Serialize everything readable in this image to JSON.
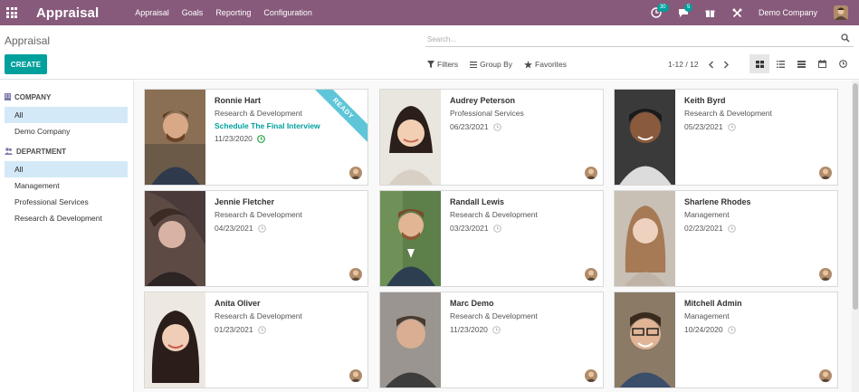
{
  "navbar": {
    "brand": "Appraisal",
    "menu": [
      {
        "label": "Appraisal"
      },
      {
        "label": "Goals"
      },
      {
        "label": "Reporting"
      },
      {
        "label": "Configuration"
      }
    ],
    "activity_count": "30",
    "messages_count": "5",
    "company": "Demo Company",
    "accent": "#875a7b"
  },
  "control_panel": {
    "breadcrumb": "Appraisal",
    "search_placeholder": "Search...",
    "create_label": "CREATE",
    "filters_label": "Filters",
    "groupby_label": "Group By",
    "favorites_label": "Favorites",
    "pager": "1-12 / 12",
    "views": [
      "kanban-icon",
      "list-icon",
      "gantt-icon",
      "calendar-icon",
      "activity-icon"
    ],
    "active_view": "kanban-icon"
  },
  "sidebar": {
    "company_header": "COMPANY",
    "company_items": [
      {
        "label": "All",
        "active": true
      },
      {
        "label": "Demo Company",
        "active": false
      }
    ],
    "department_header": "DEPARTMENT",
    "department_items": [
      {
        "label": "All",
        "active": true
      },
      {
        "label": "Management",
        "active": false
      },
      {
        "label": "Professional Services",
        "active": false
      },
      {
        "label": "Research & Development",
        "active": false
      }
    ]
  },
  "cards": [
    {
      "name": "Ronnie Hart",
      "department": "Research & Development",
      "activity": "Schedule The Final Interview",
      "date": "11/23/2020",
      "ribbon": "READY",
      "status_color": "#28a745"
    },
    {
      "name": "Audrey Peterson",
      "department": "Professional Services",
      "date": "06/23/2021"
    },
    {
      "name": "Keith Byrd",
      "department": "Research & Development",
      "date": "05/23/2021"
    },
    {
      "name": "Jennie Fletcher",
      "department": "Research & Development",
      "date": "04/23/2021"
    },
    {
      "name": "Randall Lewis",
      "department": "Research & Development",
      "date": "03/23/2021"
    },
    {
      "name": "Sharlene Rhodes",
      "department": "Management",
      "date": "02/23/2021"
    },
    {
      "name": "Anita Oliver",
      "department": "Research & Development",
      "date": "01/23/2021"
    },
    {
      "name": "Marc Demo",
      "department": "Research & Development",
      "date": "11/23/2020"
    },
    {
      "name": "Mitchell Admin",
      "department": "Management",
      "date": "10/24/2020"
    }
  ],
  "colors": {
    "primary": "#00a09d",
    "ribbon": "#5ec6d8",
    "sidebar_active": "#d4e9f7"
  }
}
